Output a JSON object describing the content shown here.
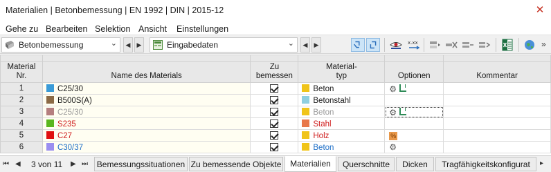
{
  "window": {
    "title": "Materialien | Betonbemessung | EN 1992 | DIN | 2015-12",
    "close_glyph": "✕"
  },
  "menu": [
    "Gehe zu",
    "Bearbeiten",
    "Selektion",
    "Ansicht",
    "Einstellungen"
  ],
  "toolbar": {
    "module_combo": "Betonbemessung",
    "data_combo": "Eingabedaten",
    "icons": [
      "select-icon",
      "deselect-icon",
      "eye-icon",
      "xxx-icon",
      "insert-row-icon",
      "delete-row-icon",
      "move-up-icon",
      "move-down-icon",
      "excel-icon",
      "globe-icon"
    ],
    "overflow": "»"
  },
  "table": {
    "headers": {
      "nr": [
        "Material",
        "Nr."
      ],
      "name": "Name des Materials",
      "design": [
        "Zu",
        "bemessen"
      ],
      "type": [
        "Material-",
        "typ"
      ],
      "options": "Optionen",
      "comment": "Kommentar"
    },
    "rows": [
      {
        "nr": "1",
        "name": "C25/30",
        "swatch": "#3a9bd8",
        "name_color": "#1a1a1a",
        "type": "Beton",
        "type_swatch": "#f0c419",
        "type_color": "#1a1a1a",
        "options": [
          "gear",
          "beam"
        ]
      },
      {
        "nr": "2",
        "name": "B500S(A)",
        "swatch": "#8b6a45",
        "name_color": "#1a1a1a",
        "type": "Betonstahl",
        "type_swatch": "#8fcfe0",
        "type_color": "#1a1a1a",
        "options": []
      },
      {
        "nr": "3",
        "name": "C25/30",
        "swatch": "#b57f7f",
        "name_color": "#9a9a9a",
        "type": "Beton",
        "type_swatch": "#f0c419",
        "type_color": "#9a9a9a",
        "options": [
          "gear",
          "beam"
        ]
      },
      {
        "nr": "4",
        "name": "S235",
        "swatch": "#5ab61e",
        "name_color": "#d02020",
        "type": "Stahl",
        "type_swatch": "#e8784a",
        "type_color": "#d02020",
        "options": []
      },
      {
        "nr": "5",
        "name": "C27",
        "swatch": "#e01010",
        "name_color": "#d02020",
        "type": "Holz",
        "type_swatch": "#f0c419",
        "type_color": "#d02020",
        "options": [
          "percent"
        ]
      },
      {
        "nr": "6",
        "name": "C30/37",
        "swatch": "#9a8ef0",
        "name_color": "#2070c8",
        "type": "Beton",
        "type_swatch": "#f0c419",
        "type_color": "#2070c8",
        "options": [
          "gear"
        ]
      }
    ]
  },
  "statusbar": {
    "page": "3 von 11",
    "tabs": [
      "Bemessungssituationen",
      "Zu bemessende Objekte",
      "Materialien",
      "Querschnitte",
      "Dicken",
      "Tragfähigkeitskonfigurat"
    ],
    "active_tab": "Materialien"
  }
}
